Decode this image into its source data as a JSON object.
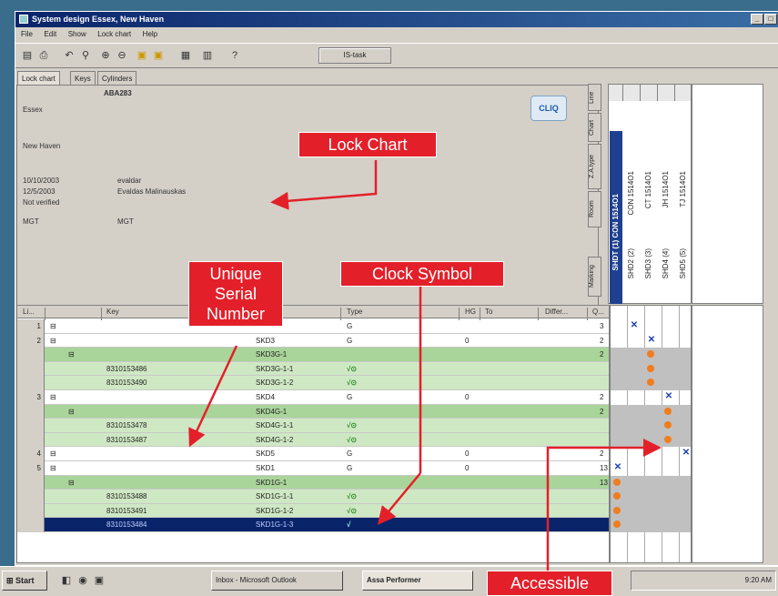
{
  "window": {
    "title": "System design Essex, New Haven",
    "min": "_",
    "max": "□"
  },
  "menu": [
    "File",
    "Edit",
    "Show",
    "Lock chart",
    "Help"
  ],
  "toolbar": {
    "button_label": "IS-task"
  },
  "tabs": [
    "Lock chart",
    "Keys",
    "Cylinders"
  ],
  "info": {
    "code": "ABA283",
    "line1": "Essex",
    "line2": "New Haven",
    "date1": "10/10/2003",
    "user1": "evaldar",
    "date2": "12/5/2003",
    "user2": "Evaldas Malinauskas",
    "status": "Not verified",
    "mgt1": "MGT",
    "mgt2": "MGT"
  },
  "cliq_label": "CLIQ",
  "vtabs": [
    "Line",
    "Chart",
    "Z.A.type",
    "Room",
    "Marking"
  ],
  "columns": {
    "head": "SHDT (1) CON 1514O1",
    "cols": [
      {
        "a": "SHD2 (2)",
        "b": "CON 1514O1"
      },
      {
        "a": "SHD3 (3)",
        "b": "CT 1514O1"
      },
      {
        "a": "SHD4 (4)",
        "b": "JH 1514O1"
      },
      {
        "a": "SHD5 (5)",
        "b": "TJ 1514O1"
      }
    ]
  },
  "grid": {
    "headers": [
      "Li...",
      "Key",
      "Type",
      "HG",
      "To",
      "Differ...",
      "Q..."
    ],
    "rows": [
      {
        "num": "1",
        "key": "",
        "name": "",
        "type": "G",
        "hg": "",
        "q": "3",
        "style": "white",
        "symbol": ""
      },
      {
        "num": "2",
        "key": "",
        "name": "SKD3",
        "type": "G",
        "hg": "0",
        "q": "2",
        "style": "white",
        "symbol": ""
      },
      {
        "num": "",
        "key": "",
        "name": "SKD3G-1",
        "type": "",
        "hg": "",
        "q": "2",
        "style": "green",
        "symbol": ""
      },
      {
        "num": "",
        "key": "8310153486",
        "name": "SKD3G-1-1",
        "type": "",
        "hg": "",
        "q": "",
        "style": "greenlight",
        "symbol": "√⊙"
      },
      {
        "num": "",
        "key": "8310153490",
        "name": "SKD3G-1-2",
        "type": "",
        "hg": "",
        "q": "",
        "style": "greenlight",
        "symbol": "√⊙"
      },
      {
        "num": "3",
        "key": "",
        "name": "SKD4",
        "type": "G",
        "hg": "0",
        "q": "2",
        "style": "white",
        "symbol": ""
      },
      {
        "num": "",
        "key": "",
        "name": "SKD4G-1",
        "type": "",
        "hg": "",
        "q": "2",
        "style": "green",
        "symbol": ""
      },
      {
        "num": "",
        "key": "8310153478",
        "name": "SKD4G-1-1",
        "type": "",
        "hg": "",
        "q": "",
        "style": "greenlight",
        "symbol": "√⊙"
      },
      {
        "num": "",
        "key": "8310153487",
        "name": "SKD4G-1-2",
        "type": "",
        "hg": "",
        "q": "",
        "style": "greenlight",
        "symbol": "√⊙"
      },
      {
        "num": "4",
        "key": "",
        "name": "SKD5",
        "type": "G",
        "hg": "0",
        "q": "2",
        "style": "white",
        "symbol": ""
      },
      {
        "num": "5",
        "key": "",
        "name": "SKD1",
        "type": "G",
        "hg": "0",
        "q": "13",
        "style": "white",
        "symbol": ""
      },
      {
        "num": "",
        "key": "",
        "name": "SKD1G-1",
        "type": "",
        "hg": "",
        "q": "13",
        "style": "green",
        "symbol": ""
      },
      {
        "num": "",
        "key": "8310153488",
        "name": "SKD1G-1-1",
        "type": "",
        "hg": "",
        "q": "",
        "style": "greenlight",
        "symbol": "√⊙"
      },
      {
        "num": "",
        "key": "8310153491",
        "name": "SKD1G-1-2",
        "type": "",
        "hg": "",
        "q": "",
        "style": "greenlight",
        "symbol": "√⊙"
      },
      {
        "num": "",
        "key": "8310153484",
        "name": "SKD1G-1-3",
        "type": "",
        "hg": "",
        "q": "",
        "style": "sel",
        "symbol": "√"
      }
    ]
  },
  "matrix": [
    {
      "gray": false,
      "marks": [
        {
          "col": 1,
          "kind": "x"
        }
      ]
    },
    {
      "gray": false,
      "marks": [
        {
          "col": 2,
          "kind": "x"
        }
      ]
    },
    {
      "gray": true,
      "marks": [
        {
          "col": 2,
          "kind": "dot"
        }
      ]
    },
    {
      "gray": true,
      "marks": [
        {
          "col": 2,
          "kind": "dot"
        }
      ]
    },
    {
      "gray": true,
      "marks": [
        {
          "col": 2,
          "kind": "dot"
        }
      ]
    },
    {
      "gray": false,
      "marks": [
        {
          "col": 3,
          "kind": "x"
        }
      ]
    },
    {
      "gray": true,
      "marks": [
        {
          "col": 3,
          "kind": "dot"
        }
      ]
    },
    {
      "gray": true,
      "marks": [
        {
          "col": 3,
          "kind": "dot"
        }
      ]
    },
    {
      "gray": true,
      "marks": [
        {
          "col": 3,
          "kind": "dot"
        }
      ]
    },
    {
      "gray": false,
      "marks": [
        {
          "col": 4,
          "kind": "x"
        }
      ]
    },
    {
      "gray": false,
      "marks": [
        {
          "col": 0,
          "kind": "x"
        }
      ]
    },
    {
      "gray": true,
      "marks": [
        {
          "col": 0,
          "kind": "dot"
        }
      ]
    },
    {
      "gray": true,
      "marks": [
        {
          "col": 0,
          "kind": "dot"
        }
      ]
    },
    {
      "gray": true,
      "marks": [
        {
          "col": 0,
          "kind": "dot"
        }
      ]
    },
    {
      "gray": true,
      "marks": [
        {
          "col": 0,
          "kind": "dot"
        }
      ]
    }
  ],
  "taskbar": {
    "start": "Start",
    "item1": "Inbox - Microsoft Outlook",
    "item2": "Assa Performer",
    "clock": "9:20 AM"
  },
  "callouts": {
    "lock_chart": "Lock Chart",
    "serial_1": "Unique",
    "serial_2": "Serial",
    "serial_3": "Number",
    "clock": "Clock Symbol",
    "accessible": "Accessible"
  },
  "colors": {
    "callout": "#e3202a",
    "green_row": "#a9d49a",
    "selected_row": "#0a246a",
    "dot": "#f07d1e",
    "x_mark": "#1a3fb0"
  }
}
